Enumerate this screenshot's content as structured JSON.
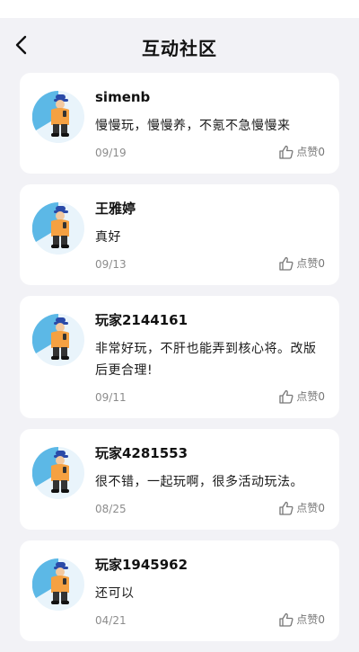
{
  "header": {
    "title": "互动社区",
    "back_icon": "chevron-left-icon"
  },
  "posts": [
    {
      "username": "simenb",
      "content": "慢慢玩，慢慢养，不氪不急慢慢来",
      "date": "09/19",
      "like_label": "点赞",
      "like_count": "0"
    },
    {
      "username": "王雅婷",
      "content": "真好",
      "date": "09/13",
      "like_label": "点赞",
      "like_count": "0"
    },
    {
      "username": "玩家2144161",
      "content": "非常好玩，不肝也能弄到核心将。改版后更合理!",
      "date": "09/11",
      "like_label": "点赞",
      "like_count": "0"
    },
    {
      "username": "玩家4281553",
      "content": "很不错，一起玩啊，很多活动玩法。",
      "date": "08/25",
      "like_label": "点赞",
      "like_count": "0"
    },
    {
      "username": "玩家1945962",
      "content": "还可以",
      "date": "04/21",
      "like_label": "点赞",
      "like_count": "0"
    }
  ],
  "colors": {
    "background": "#f2f2f6",
    "card": "#ffffff",
    "avatar_bg": "#5cb8e6",
    "avatar_shirt": "#f5a142",
    "avatar_cap": "#2a4aa8"
  }
}
